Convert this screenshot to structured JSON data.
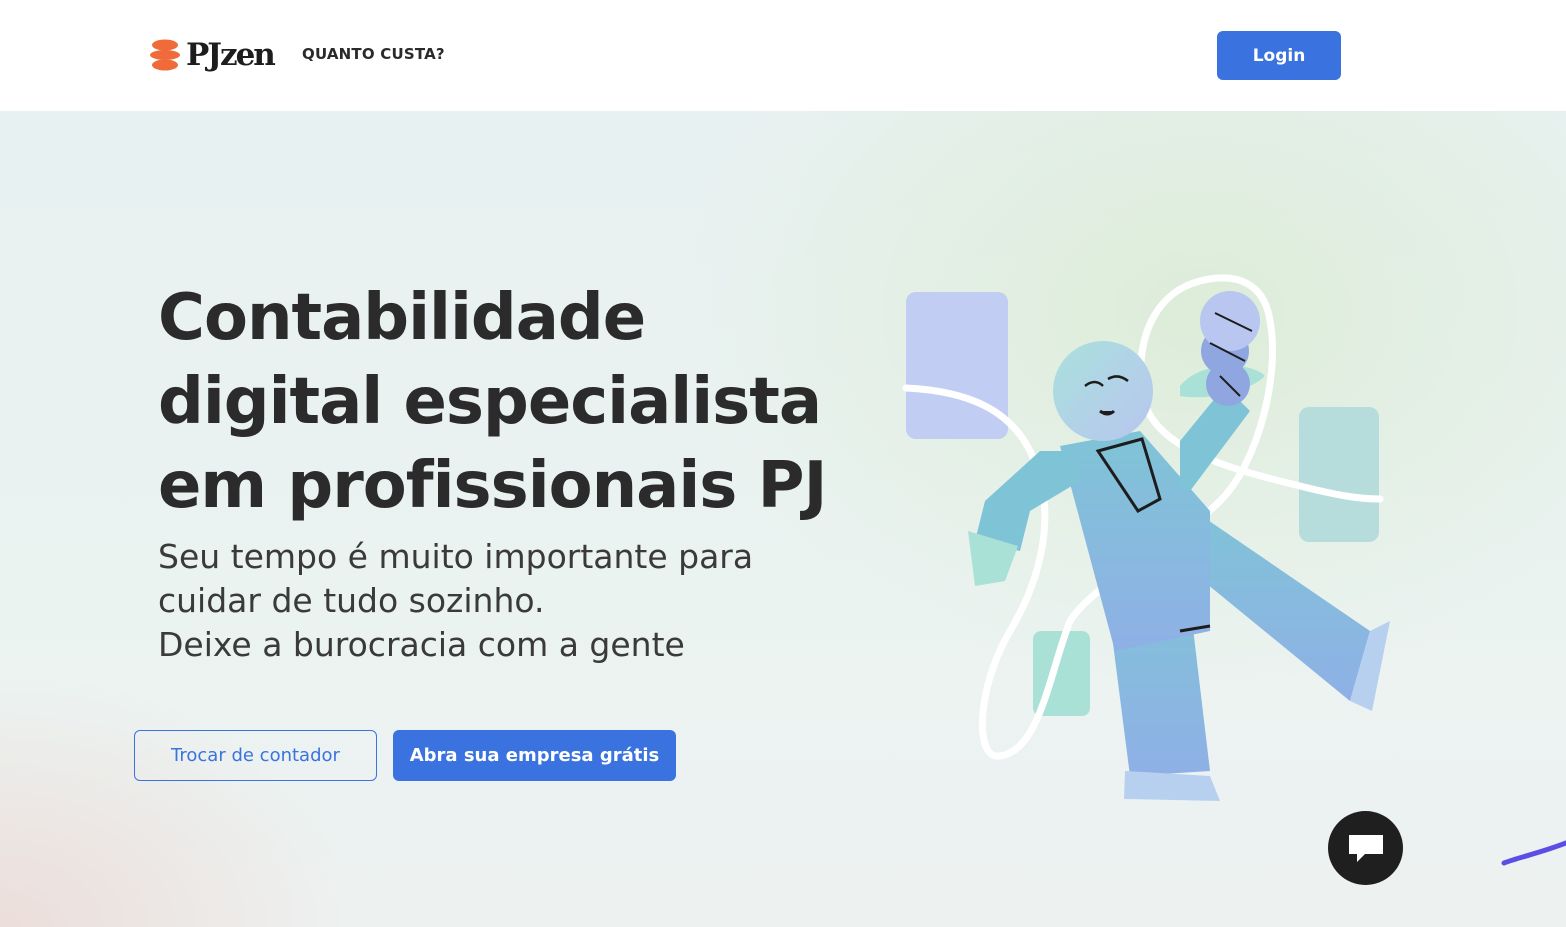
{
  "header": {
    "logo_text": "PJzen",
    "nav_link": "QUANTO CUSTA?",
    "login_label": "Login"
  },
  "hero": {
    "headline": "Contabilidade digital especialista em profissionais PJ",
    "subline_1": "Seu tempo é muito importante para cuidar de tudo sozinho.",
    "subline_2": "Deixe a burocracia com a gente",
    "secondary_cta": "Trocar de contador",
    "primary_cta": "Abra sua empresa grátis"
  },
  "colors": {
    "brand_blue": "#3a73e0",
    "logo_orange": "#ef6b3a",
    "text_dark": "#2b2b2b"
  },
  "icons": {
    "logo_mark": "stacked-discs-icon",
    "chat": "chat-bubble-icon"
  }
}
